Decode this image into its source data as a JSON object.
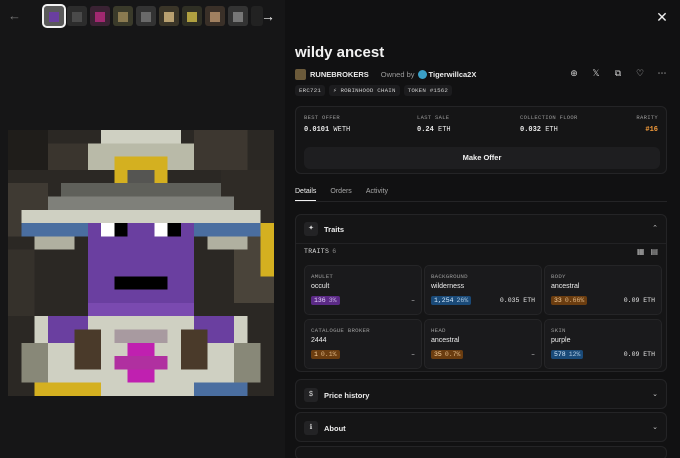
{
  "nav": {
    "back_icon": "arrow-left-icon",
    "next_icon": "arrow-right-icon",
    "close_icon": "close-icon"
  },
  "nft": {
    "title": "wildy ancest",
    "collection": "RUNEBROKERS",
    "owned_by_label": "Owned by",
    "owner": "Tigerwillca2X",
    "tags": [
      "ERC721",
      "⚡ ROBINHOOD CHAIN",
      "TOKEN #1562"
    ]
  },
  "offer": {
    "best_offer_label": "BEST OFFER",
    "best_offer_value": "0.0101",
    "best_offer_unit": "WETH",
    "last_sale_label": "LAST SALE",
    "last_sale_value": "0.24",
    "last_sale_unit": "ETH",
    "floor_label": "COLLECTION FLOOR",
    "floor_value": "0.032",
    "floor_unit": "ETH",
    "rarity_label": "RARITY",
    "rarity_value": "#16",
    "make_offer_label": "Make Offer"
  },
  "tabs": [
    "Details",
    "Orders",
    "Activity"
  ],
  "traits_section": {
    "title": "Traits",
    "count_label": "TRAITS",
    "count": "6",
    "items": [
      {
        "type": "AMULET",
        "value": "occult",
        "count": "136",
        "pct": "3%",
        "price": "–",
        "color": "purple"
      },
      {
        "type": "BACKGROUND",
        "value": "wilderness",
        "count": "1,254",
        "pct": "26%",
        "price": "0.035 ETH",
        "color": "blue"
      },
      {
        "type": "BODY",
        "value": "ancestral",
        "count": "33",
        "pct": "0.66%",
        "price": "0.09 ETH",
        "color": "orange"
      },
      {
        "type": "CATALOGUE BROKER",
        "value": "2444",
        "count": "1",
        "pct": "0.1%",
        "price": "–",
        "color": "orange"
      },
      {
        "type": "HEAD",
        "value": "ancestral",
        "count": "35",
        "pct": "0.7%",
        "price": "–",
        "color": "orange"
      },
      {
        "type": "SKIN",
        "value": "purple",
        "count": "578",
        "pct": "12%",
        "price": "0.09 ETH",
        "color": "blue"
      }
    ]
  },
  "sections": [
    {
      "title": "Price history",
      "icon": "dollar-icon"
    },
    {
      "title": "About",
      "icon": "info-icon"
    }
  ],
  "colors": {
    "accent_rarity": "#f29a3a",
    "badge_purple": "#5b2a86",
    "badge_blue": "#1a4a78",
    "badge_orange": "#6b3d10"
  }
}
